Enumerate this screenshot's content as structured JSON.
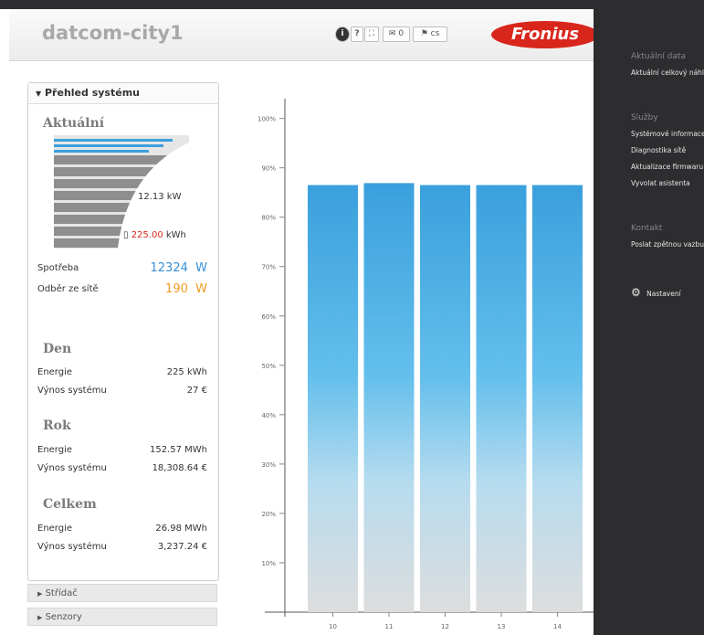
{
  "header": {
    "site_title": "datcom-city1",
    "toolbar": {
      "info": "i",
      "help": "?",
      "fullscreen": "⛶",
      "messages_icon": "✉",
      "messages_count": "0",
      "flag": "⚑",
      "language": "cs"
    },
    "logo_text": "Fronius"
  },
  "overview": {
    "title": "Přehled systému",
    "current": {
      "heading": "Aktuální",
      "power": "12.13 kW",
      "energy_prefix": "▯ ",
      "energy_value": "225.00",
      "energy_unit": " kWh",
      "consumption_label": "Spotřeba",
      "consumption_value": "12324",
      "consumption_unit": "W",
      "grid_label": "Odběr ze sítě",
      "grid_value": "190",
      "grid_unit": "W"
    },
    "day": {
      "heading": "Den",
      "energy_label": "Energie",
      "energy_value": "225 kWh",
      "yield_label": "Výnos systému",
      "yield_value": "27 €"
    },
    "year": {
      "heading": "Rok",
      "energy_label": "Energie",
      "energy_value": "152.57 MWh",
      "yield_label": "Výnos systému",
      "yield_value": "18,308.64 €"
    },
    "total": {
      "heading": "Celkem",
      "energy_label": "Energie",
      "energy_value": "26.98 MWh",
      "yield_label": "Výnos systému",
      "yield_value": "3,237.24 €"
    }
  },
  "collapsed_panels": {
    "inverter": "Střídač",
    "sensors": "Senzory"
  },
  "chart_data": {
    "type": "bar",
    "categories": [
      "10",
      "11",
      "12",
      "13",
      "14"
    ],
    "values": [
      86.5,
      86.9,
      86.5,
      86.5,
      86.5
    ],
    "yticks": [
      "10%",
      "20%",
      "30%",
      "40%",
      "50%",
      "60%",
      "70%",
      "80%",
      "90%",
      "100%"
    ],
    "ylim": [
      0,
      104
    ],
    "colors": {
      "bar_top": "#3aa0dd",
      "bar_bottom": "#dddddd"
    }
  },
  "sidebar": {
    "section_current": "Aktuální data",
    "current_items": [
      "Aktuální celkový náhl"
    ],
    "section_services": "Služby",
    "service_items": [
      "Systémové informace",
      "Diagnostika sítě",
      "Aktualizace firmwaru",
      "Vyvolat asistenta"
    ],
    "section_contact": "Kontakt",
    "contact_items": [
      "Poslat zpětnou vazbu"
    ],
    "settings_label": "Nastavení"
  },
  "colors": {
    "accent_blue": "#3a8fd6",
    "accent_orange": "#f39c24",
    "brand_red": "#d9261c"
  }
}
